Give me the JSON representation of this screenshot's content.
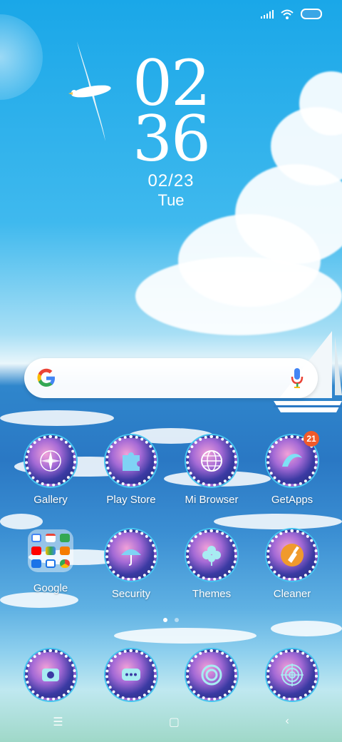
{
  "status_bar": {
    "signal_icon": "signal-icon",
    "wifi_icon": "wifi-icon",
    "battery_icon": "battery-icon"
  },
  "clock": {
    "hours": "02",
    "minutes": "36",
    "date": "02/23",
    "day": "Tue"
  },
  "search": {
    "logo_icon": "google-logo-icon",
    "mic_icon": "mic-icon"
  },
  "apps_row1": [
    {
      "label": "Gallery",
      "icon": "compass-icon"
    },
    {
      "label": "Play Store",
      "icon": "puzzle-icon"
    },
    {
      "label": "Mi Browser",
      "icon": "globe-icon"
    },
    {
      "label": "GetApps",
      "icon": "wave-icon",
      "badge": "21"
    }
  ],
  "apps_row2": [
    {
      "label": "Google",
      "icon": "folder-icon"
    },
    {
      "label": "Security",
      "icon": "umbrella-icon"
    },
    {
      "label": "Themes",
      "icon": "clover-icon"
    },
    {
      "label": "Cleaner",
      "icon": "brush-icon"
    }
  ],
  "dock": [
    {
      "icon": "phone-icon"
    },
    {
      "icon": "message-icon"
    },
    {
      "icon": "camera-icon"
    },
    {
      "icon": "radar-icon"
    }
  ],
  "page_indicator": {
    "pages": 2,
    "active": 1
  },
  "navigation": {
    "menu_icon": "menu-icon",
    "home_icon": "home-icon",
    "back_icon": "back-icon"
  }
}
